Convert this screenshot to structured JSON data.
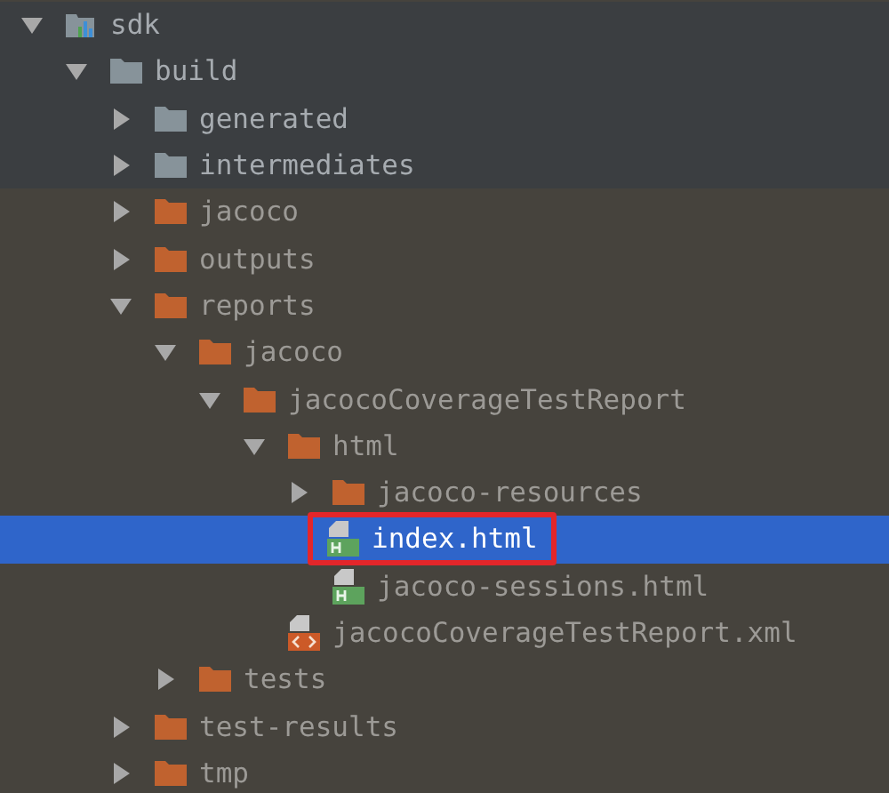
{
  "tree": [
    {
      "label": "sdk",
      "kind": "module",
      "expanded": true,
      "tinted": false,
      "selected": false,
      "outlined": false,
      "children": [
        {
          "label": "build",
          "kind": "folder",
          "color": "#87939a",
          "expanded": true,
          "tinted": false,
          "selected": false,
          "outlined": false,
          "children": [
            {
              "label": "generated",
              "kind": "folder",
              "color": "#87939a",
              "expanded": false,
              "tinted": false,
              "selected": false,
              "outlined": false
            },
            {
              "label": "intermediates",
              "kind": "folder",
              "color": "#87939a",
              "expanded": false,
              "tinted": false,
              "selected": false,
              "outlined": false
            },
            {
              "label": "jacoco",
              "kind": "folder",
              "color": "#c0622f",
              "expanded": false,
              "tinted": true,
              "selected": false,
              "outlined": false
            },
            {
              "label": "outputs",
              "kind": "folder",
              "color": "#c0622f",
              "expanded": false,
              "tinted": true,
              "selected": false,
              "outlined": false
            },
            {
              "label": "reports",
              "kind": "folder",
              "color": "#c0622f",
              "expanded": true,
              "tinted": true,
              "selected": false,
              "outlined": false,
              "children": [
                {
                  "label": "jacoco",
                  "kind": "folder",
                  "color": "#c0622f",
                  "expanded": true,
                  "tinted": true,
                  "selected": false,
                  "outlined": false,
                  "children": [
                    {
                      "label": "jacocoCoverageTestReport",
                      "kind": "folder",
                      "color": "#c0622f",
                      "expanded": true,
                      "tinted": true,
                      "selected": false,
                      "outlined": false,
                      "children": [
                        {
                          "label": "html",
                          "kind": "folder",
                          "color": "#c0622f",
                          "expanded": true,
                          "tinted": true,
                          "selected": false,
                          "outlined": false,
                          "children": [
                            {
                              "label": "jacoco-resources",
                              "kind": "folder",
                              "color": "#c0622f",
                              "expanded": false,
                              "tinted": true,
                              "selected": false,
                              "outlined": false
                            },
                            {
                              "label": "index.html",
                              "kind": "html",
                              "tinted": true,
                              "selected": true,
                              "outlined": true
                            },
                            {
                              "label": "jacoco-sessions.html",
                              "kind": "html",
                              "tinted": true,
                              "selected": false,
                              "outlined": false
                            }
                          ]
                        },
                        {
                          "label": "jacocoCoverageTestReport.xml",
                          "kind": "xml",
                          "tinted": true,
                          "selected": false,
                          "outlined": false
                        }
                      ]
                    }
                  ]
                },
                {
                  "label": "tests",
                  "kind": "folder",
                  "color": "#c0622f",
                  "expanded": false,
                  "tinted": true,
                  "selected": false,
                  "outlined": false
                }
              ]
            },
            {
              "label": "test-results",
              "kind": "folder",
              "color": "#c0622f",
              "expanded": false,
              "tinted": true,
              "selected": false,
              "outlined": false
            },
            {
              "label": "tmp",
              "kind": "folder",
              "color": "#c0622f",
              "expanded": false,
              "tinted": true,
              "selected": false,
              "outlined": false
            }
          ]
        }
      ]
    }
  ]
}
